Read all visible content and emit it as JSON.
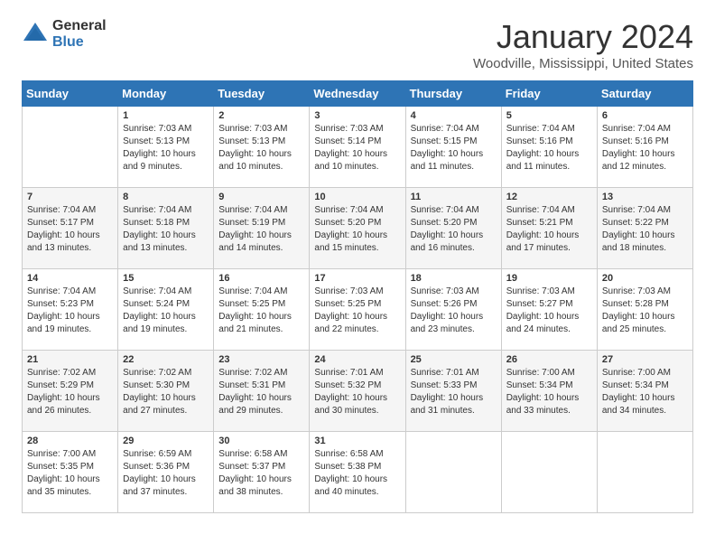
{
  "logo": {
    "text_general": "General",
    "text_blue": "Blue"
  },
  "header": {
    "title": "January 2024",
    "subtitle": "Woodville, Mississippi, United States"
  },
  "days_of_week": [
    "Sunday",
    "Monday",
    "Tuesday",
    "Wednesday",
    "Thursday",
    "Friday",
    "Saturday"
  ],
  "weeks": [
    [
      {
        "day": "",
        "info": ""
      },
      {
        "day": "1",
        "info": "Sunrise: 7:03 AM\nSunset: 5:13 PM\nDaylight: 10 hours\nand 9 minutes."
      },
      {
        "day": "2",
        "info": "Sunrise: 7:03 AM\nSunset: 5:13 PM\nDaylight: 10 hours\nand 10 minutes."
      },
      {
        "day": "3",
        "info": "Sunrise: 7:03 AM\nSunset: 5:14 PM\nDaylight: 10 hours\nand 10 minutes."
      },
      {
        "day": "4",
        "info": "Sunrise: 7:04 AM\nSunset: 5:15 PM\nDaylight: 10 hours\nand 11 minutes."
      },
      {
        "day": "5",
        "info": "Sunrise: 7:04 AM\nSunset: 5:16 PM\nDaylight: 10 hours\nand 11 minutes."
      },
      {
        "day": "6",
        "info": "Sunrise: 7:04 AM\nSunset: 5:16 PM\nDaylight: 10 hours\nand 12 minutes."
      }
    ],
    [
      {
        "day": "7",
        "info": "Sunrise: 7:04 AM\nSunset: 5:17 PM\nDaylight: 10 hours\nand 13 minutes."
      },
      {
        "day": "8",
        "info": "Sunrise: 7:04 AM\nSunset: 5:18 PM\nDaylight: 10 hours\nand 13 minutes."
      },
      {
        "day": "9",
        "info": "Sunrise: 7:04 AM\nSunset: 5:19 PM\nDaylight: 10 hours\nand 14 minutes."
      },
      {
        "day": "10",
        "info": "Sunrise: 7:04 AM\nSunset: 5:20 PM\nDaylight: 10 hours\nand 15 minutes."
      },
      {
        "day": "11",
        "info": "Sunrise: 7:04 AM\nSunset: 5:20 PM\nDaylight: 10 hours\nand 16 minutes."
      },
      {
        "day": "12",
        "info": "Sunrise: 7:04 AM\nSunset: 5:21 PM\nDaylight: 10 hours\nand 17 minutes."
      },
      {
        "day": "13",
        "info": "Sunrise: 7:04 AM\nSunset: 5:22 PM\nDaylight: 10 hours\nand 18 minutes."
      }
    ],
    [
      {
        "day": "14",
        "info": "Sunrise: 7:04 AM\nSunset: 5:23 PM\nDaylight: 10 hours\nand 19 minutes."
      },
      {
        "day": "15",
        "info": "Sunrise: 7:04 AM\nSunset: 5:24 PM\nDaylight: 10 hours\nand 19 minutes."
      },
      {
        "day": "16",
        "info": "Sunrise: 7:04 AM\nSunset: 5:25 PM\nDaylight: 10 hours\nand 21 minutes."
      },
      {
        "day": "17",
        "info": "Sunrise: 7:03 AM\nSunset: 5:25 PM\nDaylight: 10 hours\nand 22 minutes."
      },
      {
        "day": "18",
        "info": "Sunrise: 7:03 AM\nSunset: 5:26 PM\nDaylight: 10 hours\nand 23 minutes."
      },
      {
        "day": "19",
        "info": "Sunrise: 7:03 AM\nSunset: 5:27 PM\nDaylight: 10 hours\nand 24 minutes."
      },
      {
        "day": "20",
        "info": "Sunrise: 7:03 AM\nSunset: 5:28 PM\nDaylight: 10 hours\nand 25 minutes."
      }
    ],
    [
      {
        "day": "21",
        "info": "Sunrise: 7:02 AM\nSunset: 5:29 PM\nDaylight: 10 hours\nand 26 minutes."
      },
      {
        "day": "22",
        "info": "Sunrise: 7:02 AM\nSunset: 5:30 PM\nDaylight: 10 hours\nand 27 minutes."
      },
      {
        "day": "23",
        "info": "Sunrise: 7:02 AM\nSunset: 5:31 PM\nDaylight: 10 hours\nand 29 minutes."
      },
      {
        "day": "24",
        "info": "Sunrise: 7:01 AM\nSunset: 5:32 PM\nDaylight: 10 hours\nand 30 minutes."
      },
      {
        "day": "25",
        "info": "Sunrise: 7:01 AM\nSunset: 5:33 PM\nDaylight: 10 hours\nand 31 minutes."
      },
      {
        "day": "26",
        "info": "Sunrise: 7:00 AM\nSunset: 5:34 PM\nDaylight: 10 hours\nand 33 minutes."
      },
      {
        "day": "27",
        "info": "Sunrise: 7:00 AM\nSunset: 5:34 PM\nDaylight: 10 hours\nand 34 minutes."
      }
    ],
    [
      {
        "day": "28",
        "info": "Sunrise: 7:00 AM\nSunset: 5:35 PM\nDaylight: 10 hours\nand 35 minutes."
      },
      {
        "day": "29",
        "info": "Sunrise: 6:59 AM\nSunset: 5:36 PM\nDaylight: 10 hours\nand 37 minutes."
      },
      {
        "day": "30",
        "info": "Sunrise: 6:58 AM\nSunset: 5:37 PM\nDaylight: 10 hours\nand 38 minutes."
      },
      {
        "day": "31",
        "info": "Sunrise: 6:58 AM\nSunset: 5:38 PM\nDaylight: 10 hours\nand 40 minutes."
      },
      {
        "day": "",
        "info": ""
      },
      {
        "day": "",
        "info": ""
      },
      {
        "day": "",
        "info": ""
      }
    ]
  ]
}
